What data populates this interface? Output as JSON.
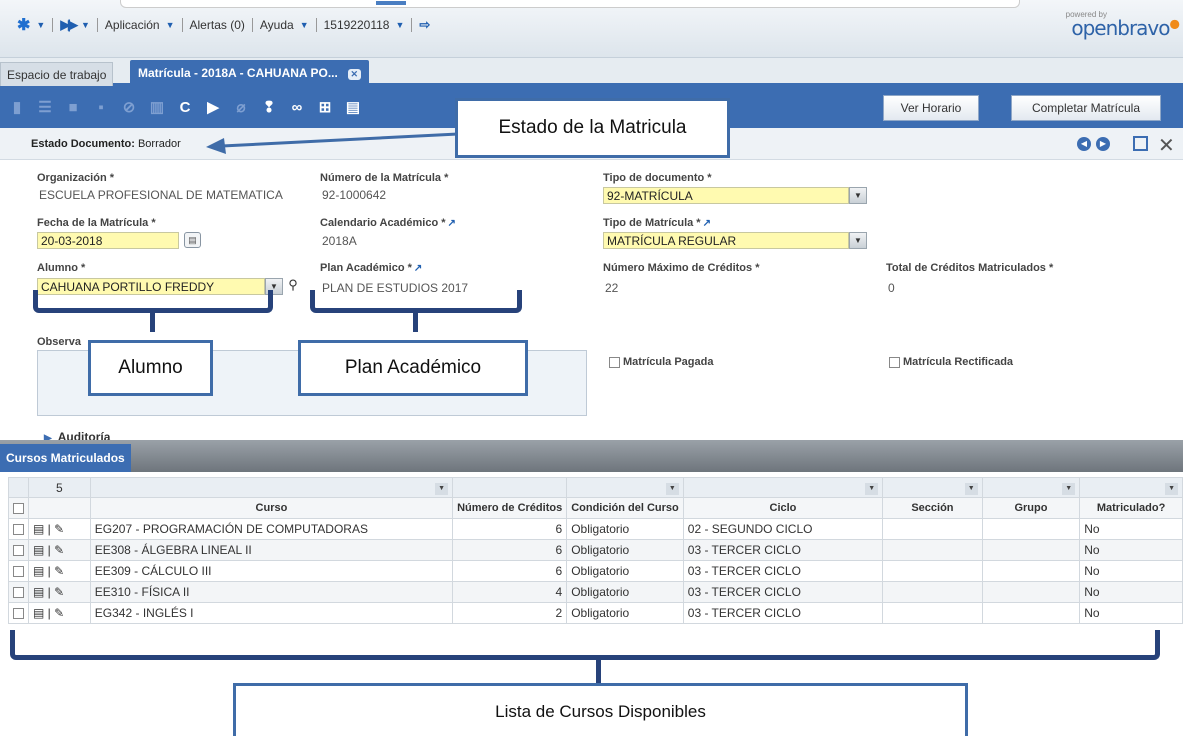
{
  "nav": {
    "menu_aplicacion": "Aplicación",
    "alertas": "Alertas (0)",
    "ayuda": "Ayuda",
    "user_id": "1519220118",
    "logo_powered": "powered by",
    "logo_name": "openbravo"
  },
  "tabs": {
    "workspace": "Espacio de trabajo",
    "active": "Matrícula - 2018A - CAHUANA PO..."
  },
  "toolbar": {
    "ver_horario": "Ver Horario",
    "completar": "Completar Matrícula"
  },
  "status": {
    "label": "Estado Documento:",
    "value": "Borrador"
  },
  "form": {
    "organizacion_label": "Organización *",
    "organizacion_value": "ESCUELA PROFESIONAL DE MATEMATICA",
    "numero_label": "Número de la Matrícula *",
    "numero_value": "92-1000642",
    "tipo_doc_label": "Tipo de documento *",
    "tipo_doc_value": "92-MATRÍCULA",
    "fecha_label": "Fecha de la Matrícula *",
    "fecha_value": "20-03-2018",
    "calendario_label": "Calendario Académico *",
    "calendario_value": "2018A",
    "tipo_mat_label": "Tipo de Matrícula *",
    "tipo_mat_value": "MATRÍCULA REGULAR",
    "alumno_label": "Alumno *",
    "alumno_value": "CAHUANA PORTILLO FREDDY",
    "plan_label": "Plan Académico *",
    "plan_value": "PLAN DE ESTUDIOS 2017",
    "max_creditos_label": "Número Máximo de Créditos *",
    "max_creditos_value": "22",
    "total_creditos_label": "Total de Créditos Matriculados *",
    "total_creditos_value": "0",
    "observaciones_label": "Observa",
    "pagada_label": "Matrícula Pagada",
    "rectificada_label": "Matrícula Rectificada",
    "auditoria_label": "Auditoría"
  },
  "grid": {
    "tab_label": "Cursos Matriculados",
    "row_count": "5",
    "columns": [
      "Curso",
      "Número de Créditos",
      "Condición del Curso",
      "Ciclo",
      "Sección",
      "Grupo",
      "Matriculado?"
    ],
    "rows": [
      {
        "curso": "EG207 - PROGRAMACIÓN DE COMPUTADORAS",
        "creditos": "6",
        "condicion": "Obligatorio",
        "ciclo": "02 - SEGUNDO CICLO",
        "seccion": "",
        "grupo": "",
        "matriculado": "No"
      },
      {
        "curso": "EE308 - ÁLGEBRA LINEAL II",
        "creditos": "6",
        "condicion": "Obligatorio",
        "ciclo": "03 - TERCER CICLO",
        "seccion": "",
        "grupo": "",
        "matriculado": "No"
      },
      {
        "curso": "EE309 - CÁLCULO III",
        "creditos": "6",
        "condicion": "Obligatorio",
        "ciclo": "03 - TERCER CICLO",
        "seccion": "",
        "grupo": "",
        "matriculado": "No"
      },
      {
        "curso": "EE310 - FÍSICA II",
        "creditos": "4",
        "condicion": "Obligatorio",
        "ciclo": "03 - TERCER CICLO",
        "seccion": "",
        "grupo": "",
        "matriculado": "No"
      },
      {
        "curso": "EG342 - INGLÉS I",
        "creditos": "2",
        "condicion": "Obligatorio",
        "ciclo": "03 - TERCER CICLO",
        "seccion": "",
        "grupo": "",
        "matriculado": "No"
      }
    ]
  },
  "annotations": {
    "estado": "Estado de la Matricula",
    "alumno": "Alumno",
    "plan": "Plan Académico",
    "lista": "Lista de Cursos Disponibles"
  },
  "colors": {
    "brand_blue": "#3c6db2",
    "required_field": "#fffab0",
    "annotation_dark": "#27427a"
  }
}
